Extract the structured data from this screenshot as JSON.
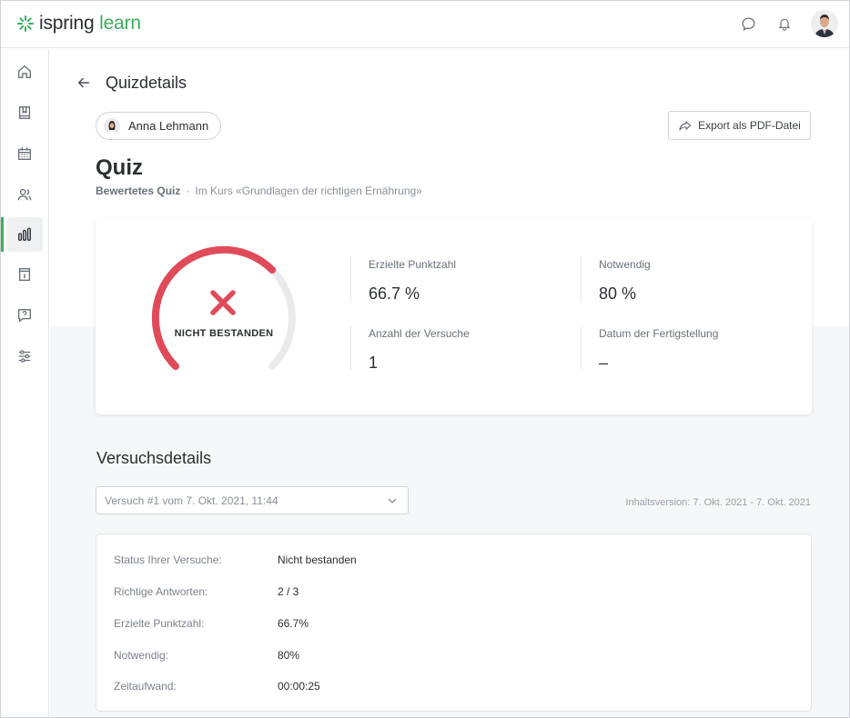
{
  "app": {
    "logo_part1": "ispring",
    "logo_part2": "learn"
  },
  "colors": {
    "brand": "#3dae5c",
    "fail": "#e04b5a",
    "gauge_track": "#e9eaec"
  },
  "topbar": {
    "icons": [
      "chat-icon",
      "bell-icon",
      "user-avatar"
    ]
  },
  "sidebar": {
    "items": [
      {
        "icon": "home-icon"
      },
      {
        "icon": "book-icon"
      },
      {
        "icon": "calendar-icon"
      },
      {
        "icon": "users-icon"
      },
      {
        "icon": "reports-icon",
        "active": true
      },
      {
        "icon": "info-page-icon"
      },
      {
        "icon": "help-chat-icon"
      },
      {
        "icon": "settings-sliders-icon"
      }
    ]
  },
  "header": {
    "title": "Quizdetails",
    "user_name": "Anna Lehmann",
    "export_label": "Export als PDF-Datei"
  },
  "quiz": {
    "title": "Quiz",
    "type": "Bewertetes Quiz",
    "separator": "·",
    "course": "Im Kurs «Grundlagen der richtigen Ernährung»"
  },
  "result": {
    "status": "NICHT BESTANDEN",
    "score_fraction": 0.667,
    "stats": [
      {
        "label": "Erzielte Punktzahl",
        "value": "66.7 %"
      },
      {
        "label": "Notwendig",
        "value": "80 %"
      },
      {
        "label": "Anzahl der Versuche",
        "value": "1"
      },
      {
        "label": "Datum der Fertigstellung",
        "value": "–"
      }
    ]
  },
  "attempts": {
    "title": "Versuchsdetails",
    "selected": "Versuch #1 vom 7. Okt. 2021, 11:44",
    "version": "Inhaltsversion: 7. Okt. 2021 - 7. Okt. 2021",
    "rows": [
      {
        "key": "Status Ihrer Versuche:",
        "value": "Nicht bestanden"
      },
      {
        "key": "Richtige Antworten:",
        "value": "2 / 3"
      },
      {
        "key": "Erzielte Punktzahl:",
        "value": "66.7%"
      },
      {
        "key": "Notwendig:",
        "value": "80%"
      },
      {
        "key": "Zeitaufwand:",
        "value": "00:00:25"
      }
    ]
  }
}
